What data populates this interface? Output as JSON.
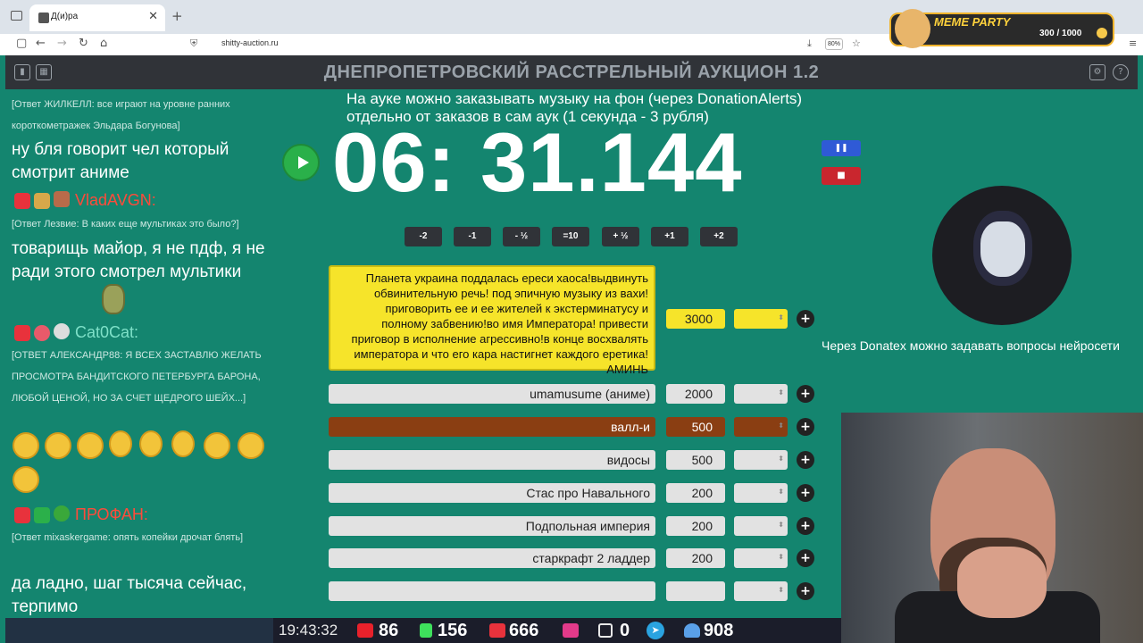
{
  "browser": {
    "tab_title": "Д(и)ра",
    "close_glyph": "✕",
    "new_tab_glyph": "+",
    "url": "shitty-auction.ru",
    "zoom": "80%",
    "back_glyph": "←",
    "forward_glyph": "→",
    "reload_glyph": "↻",
    "home_glyph": "⌂",
    "lock_glyph": "⛨",
    "download_glyph": "⤓",
    "star_glyph": "☆",
    "menu_glyph": "≡"
  },
  "meme_party": {
    "logo": "MEME PARTY",
    "points": "300 / 1000"
  },
  "header": {
    "title": "ДНЕПРОПЕТРОВСКИЙ РАССТРЕЛЬНЫЙ АУКЦИОН 1.2",
    "left_btn_1": "▮",
    "left_btn_2": "▦",
    "settings_glyph": "⚙",
    "help_glyph": "?"
  },
  "chat": {
    "messages": [
      {
        "reply": "[Ответ ЖИЛКЕЛЛ: все играют на уровне ранних короткометражек Эльдара Богунова]",
        "text": "ну бля говорит чел который смотрит аниме"
      },
      {
        "user": "VladAVGN:",
        "user_color": "#ff4b3a",
        "reply": "[Ответ Лезвие: В каких еще мультиках это было?]",
        "text": "товарищь майор, я не пдф, я не ради этого смотрел мультики"
      },
      {
        "user": "Cat0Cat:",
        "user_color": "#7ee0c8",
        "reply": "[Ответ Александр88: Я ВСЕХ ЗАСТАВЛЮ ЖЕЛАТЬ ПРОСМОТРА БАНДИТСКОГО ПЕТЕРБУРГА БАРОНА, ЛЮБОЙ ЦЕНОЙ, НО ЗА СЧЕТ ЩЕДРОГО ШЕЙХ...]"
      },
      {
        "user": "ПРОФАН:",
        "user_color": "#ff4b3a",
        "reply": "[Ответ mixaskergame: опять копейки дрочат блять]",
        "text": "да ладно, шаг тысяча сейчас, терпимо"
      }
    ]
  },
  "auction": {
    "notice_line1": "На ауке можно заказывать музыку на фон (через DonationAlerts)",
    "notice_line2": "отдельно от заказов в сам аук (1 секунда - 3 рубля)",
    "timer": "06: 31.144",
    "pause_glyph": "❚❚",
    "stop_glyph": "■",
    "adjust_buttons": [
      "-2",
      "-1",
      "- ½",
      "=10",
      "+ ½",
      "+1",
      "+2"
    ],
    "plus_glyph": "+",
    "lots": [
      {
        "name": "Планета украина поддалась ереси хаоса!выдвинуть обвинительную речь! под эпичную музыку из вахи! приговорить ее и ее жителей к экстерминатусу и полному забвению!во имя Императора! привести приговор в исполнение агрессивно!в конце восхвалять императора и что его кара настигнет каждого еретика! АМИНЬ",
        "amount": "3000",
        "style": "yellow"
      },
      {
        "name": "umamusume (аниме)",
        "amount": "2000",
        "style": "grey"
      },
      {
        "name": "валл-и",
        "amount": "500",
        "style": "brown"
      },
      {
        "name": "видосы",
        "amount": "500",
        "style": "grey"
      },
      {
        "name": "Стас про Навального",
        "amount": "200",
        "style": "grey"
      },
      {
        "name": "Подпольная империя",
        "amount": "200",
        "style": "grey"
      },
      {
        "name": "старкрафт 2 ладдер",
        "amount": "200",
        "style": "grey"
      },
      {
        "name": "",
        "amount": "",
        "style": "grey"
      }
    ]
  },
  "donatex_text": "Через Donatex можно задавать вопросы нейросети",
  "stream_stats": {
    "time": "19:43:32",
    "youtube": "86",
    "kick": "156",
    "vk_live": "666",
    "rutube": "0",
    "telegram_glyph": "➤",
    "viewers": "908"
  },
  "colors": {
    "accent": "#14856f",
    "header_bg": "#303338",
    "lot_yellow": "#f6e42a",
    "lot_brown": "#8a3e12"
  }
}
